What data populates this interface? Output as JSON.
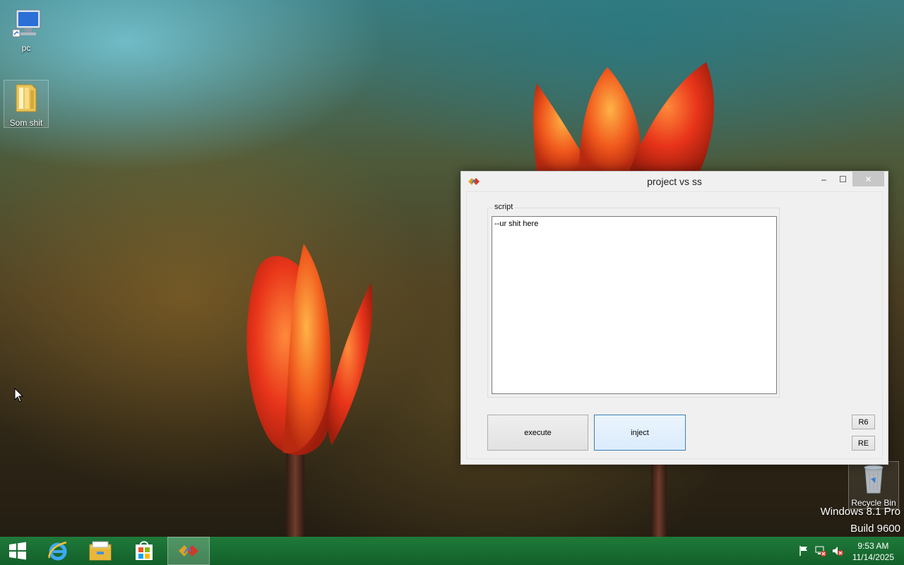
{
  "desktop": {
    "icons": [
      {
        "label": "pc",
        "icon": "computer-icon"
      },
      {
        "label": "Som shit",
        "icon": "folder-icon"
      },
      {
        "label": "Recycle Bin",
        "icon": "recycle-bin-icon"
      }
    ],
    "watermark": {
      "line1": "Windows 8.1 Pro",
      "line2": "Build 9600"
    }
  },
  "window": {
    "title": "project vs ss",
    "group_label": "script",
    "script_text": "--ur shit here",
    "buttons": {
      "execute": "execute",
      "inject": "inject",
      "r6": "R6",
      "re": "RE"
    },
    "controls": {
      "minimize": "–",
      "maximize": "☐",
      "close": "✕"
    }
  },
  "taskbar": {
    "items": [
      "start-icon",
      "internet-explorer-icon",
      "file-explorer-icon",
      "store-icon",
      "project-app-icon"
    ],
    "clock": {
      "time": "9:53 AM",
      "date": "11/14/2025"
    }
  },
  "colors": {
    "taskbar": "#13602a",
    "window_bg": "#f0f0f0",
    "close_button": "#c7c7c7"
  }
}
